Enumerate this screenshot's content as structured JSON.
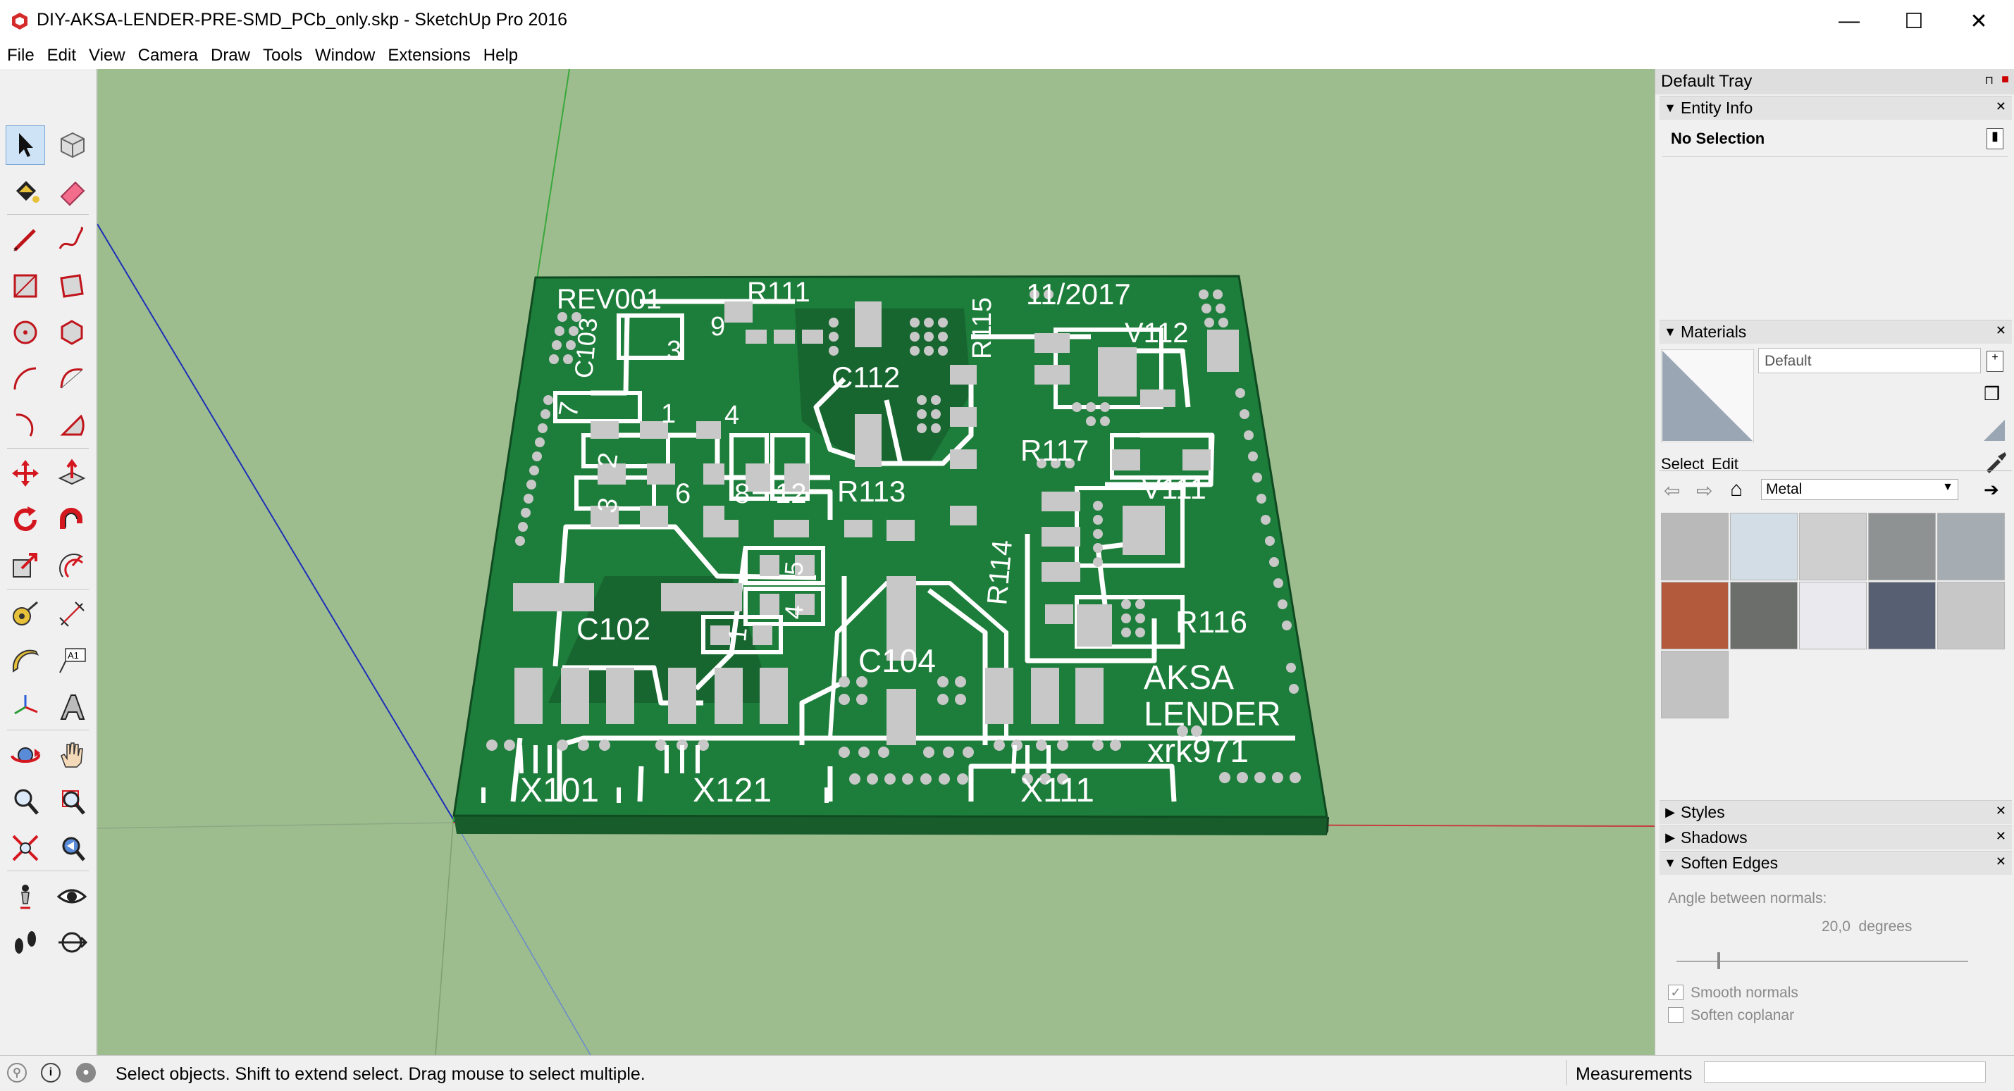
{
  "window": {
    "title": "DIY-AKSA-LENDER-PRE-SMD_PCb_only.skp - SketchUp Pro 2016",
    "controls": {
      "minimize": "—",
      "maximize": "☐",
      "close": "✕"
    }
  },
  "menu": [
    "File",
    "Edit",
    "View",
    "Camera",
    "Draw",
    "Tools",
    "Window",
    "Extensions",
    "Help"
  ],
  "toolbar": {
    "tools": [
      "select-icon",
      "make-component-icon",
      "paint-bucket-icon",
      "eraser-icon",
      "line-icon",
      "freehand-icon",
      "rectangle-icon",
      "rotated-rectangle-icon",
      "circle-icon",
      "polygon-icon",
      "arc-icon",
      "two-point-arc-icon",
      "three-point-arc-icon",
      "pie-icon",
      "move-icon",
      "push-pull-icon",
      "rotate-icon",
      "follow-me-icon",
      "scale-icon",
      "offset-icon",
      "tape-measure-icon",
      "dimension-icon",
      "protractor-icon",
      "text-icon",
      "axes-icon",
      "3d-text-icon",
      "orbit-icon",
      "pan-icon",
      "zoom-icon",
      "zoom-window-icon",
      "zoom-extents-icon",
      "previous-view-icon",
      "position-camera-icon",
      "look-around-icon",
      "walk-icon",
      "section-plane-icon"
    ],
    "text_tool_label": "A1"
  },
  "pcb": {
    "labels": {
      "rev": "REV001",
      "date": "11/2017",
      "r111": "R111",
      "r115": "R115",
      "c103": "C103",
      "v112": "V112",
      "c112": "C112",
      "r117": "R117",
      "r113": "R113",
      "v111": "V111",
      "r114": "R114",
      "c102": "C102",
      "c104": "C104",
      "r116": "R116",
      "aksa": "AKSA",
      "lender": "LENDER",
      "xrk": "xrk971",
      "x101": "X101",
      "x121": "X121",
      "x111": "X111",
      "n9": "9",
      "n3a": "3",
      "n7": "7",
      "n1a": "1",
      "n4a": "4",
      "n2": "2",
      "n6": "6",
      "n8": "8",
      "n12": "12",
      "n3b": "3",
      "n5": "5",
      "n4b": "4",
      "n1b": "1"
    }
  },
  "tray": {
    "title": "Default Tray",
    "entity_info": {
      "title": "Entity Info",
      "selection": "No Selection"
    },
    "materials": {
      "title": "Materials",
      "current": "Default",
      "tab_select": "Select",
      "tab_edit": "Edit",
      "library": "Metal",
      "swatches": [
        "#b9b9b9",
        "#d2dde6",
        "#cfcfcf",
        "#8f9292",
        "#a6adb2",
        "#b45a3c",
        "#6b6e6b",
        "#e9e9ee",
        "#566072",
        "#c7c7c7",
        "#c2c2c2"
      ]
    },
    "styles": {
      "title": "Styles"
    },
    "shadows": {
      "title": "Shadows"
    },
    "soften": {
      "title": "Soften Edges",
      "angle_label": "Angle between normals:",
      "angle_value": "20,0  degrees",
      "smooth_normals": "Smooth normals",
      "soften_coplanar": "Soften coplanar",
      "smooth_checked": true,
      "coplanar_checked": false
    }
  },
  "status": {
    "text": "Select objects. Shift to extend select. Drag mouse to select multiple.",
    "measurements_label": "Measurements",
    "measurements_value": ""
  },
  "colors": {
    "sky_ground": "#9dbd8e",
    "board": "#1d7d3a",
    "board_dark": "#17652f",
    "board_side": "#185c2c",
    "trace": "#ffffff",
    "pad": "#c8c8c8",
    "accent_select": "#cfe3f7"
  }
}
